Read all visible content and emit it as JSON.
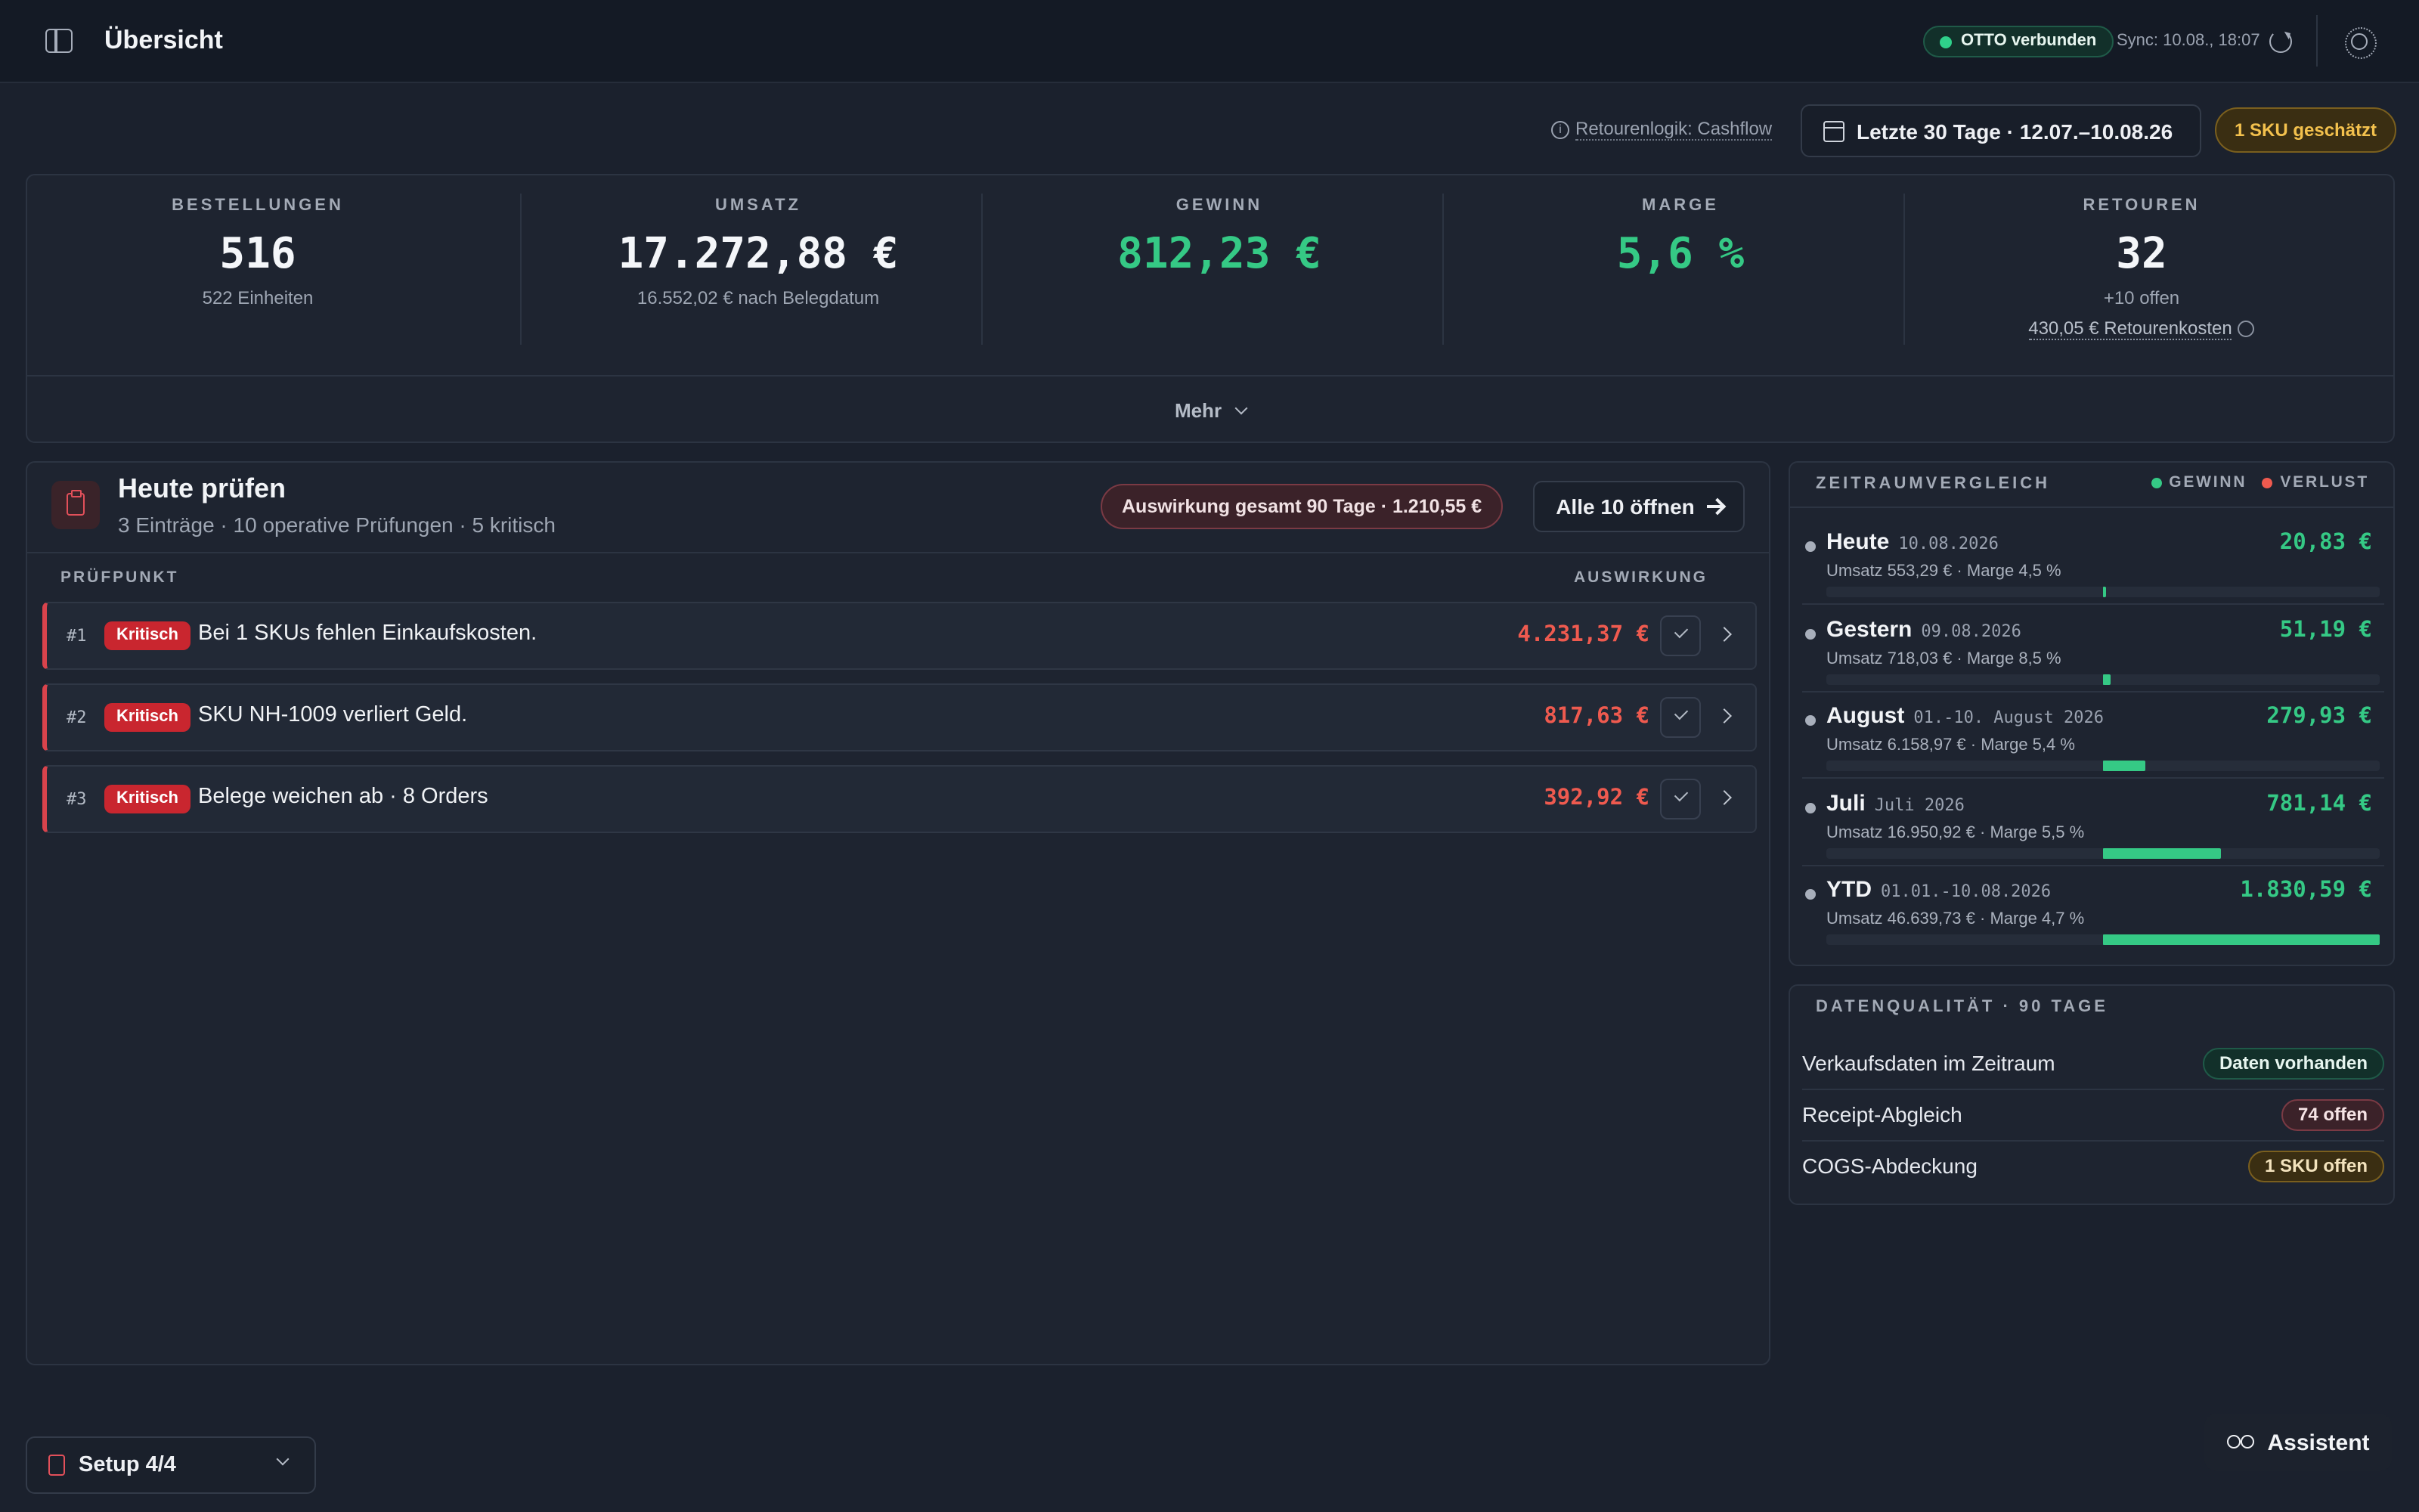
{
  "header": {
    "title": "Übersicht",
    "connection": "OTTO verbunden",
    "sync": "Sync: 10.08., 18:07",
    "icons": [
      "sidebar-toggle-icon",
      "refresh-icon",
      "sun-icon"
    ]
  },
  "filters": {
    "return_logic": "Retourenlogik: Cashflow",
    "date_range": "Letzte 30 Tage · 12.07.–10.08.26",
    "sku_estimated": "1 SKU geschätzt"
  },
  "kpis": [
    {
      "label": "BESTELLUNGEN",
      "value": "516",
      "sub": "522 Einheiten"
    },
    {
      "label": "UMSATZ",
      "value": "17.272,88 €",
      "sub": "16.552,02 € nach Belegdatum"
    },
    {
      "label": "GEWINN",
      "value": "812,23 €",
      "color": "#35c985"
    },
    {
      "label": "MARGE",
      "value": "5,6 %",
      "color": "#35c985"
    },
    {
      "label": "RETOUREN",
      "value": "32",
      "sub": "+10 offen",
      "sub2": "430,05 € Retourenkosten"
    }
  ],
  "kpi_more": "Mehr",
  "checks": {
    "title": "Heute prüfen",
    "subtitle": "3 Einträge · 10 operative Prüfungen · 5 kritisch",
    "impact_badge": "Auswirkung gesamt 90 Tage · 1.210,55 €",
    "open_all": "Alle 10 öffnen",
    "col_left": "PRÜFPUNKT",
    "col_right": "AUSWIRKUNG",
    "rows": [
      {
        "num": "#1",
        "badge": "Kritisch",
        "text": "Bei 1 SKUs fehlen Einkaufskosten.",
        "amount": "4.231,37 €"
      },
      {
        "num": "#2",
        "badge": "Kritisch",
        "text": "SKU NH-1009 verliert Geld.",
        "amount": "817,63 €"
      },
      {
        "num": "#3",
        "badge": "Kritisch",
        "text": "Belege weichen ab · 8 Orders",
        "amount": "392,92 €"
      }
    ]
  },
  "comparison": {
    "title": "ZEITRAUMVERGLEICH",
    "legend": [
      {
        "label": "GEWINN",
        "color": "#35c985"
      },
      {
        "label": "VERLUST",
        "color": "#ef5a4f"
      }
    ],
    "periods": [
      {
        "name": "Heute",
        "date": "10.08.2026",
        "value": "20,83 €",
        "sub": "Umsatz 553,29 € · Marge 4,5 %",
        "share": 0.011
      },
      {
        "name": "Gestern",
        "date": "09.08.2026",
        "value": "51,19 €",
        "sub": "Umsatz 718,03 € · Marge 8,5 %",
        "share": 0.028
      },
      {
        "name": "August",
        "date": "01.-10. August 2026",
        "value": "279,93 €",
        "sub": "Umsatz 6.158,97 € · Marge 5,4 %",
        "share": 0.153
      },
      {
        "name": "Juli",
        "date": "Juli 2026",
        "value": "781,14 €",
        "sub": "Umsatz 16.950,92 € · Marge 5,5 %",
        "share": 0.427
      },
      {
        "name": "YTD",
        "date": "01.01.-10.08.2026",
        "value": "1.830,59 €",
        "sub": "Umsatz 46.639,73 € · Marge 4,7 %",
        "share": 1.0
      }
    ]
  },
  "data_quality": {
    "title": "DATENQUALITÄT · 90 TAGE",
    "rows": [
      {
        "label": "Verkaufsdaten im Zeitraum",
        "badge": "Daten vorhanden",
        "status": "green"
      },
      {
        "label": "Receipt-Abgleich",
        "badge": "74 offen",
        "status": "red"
      },
      {
        "label": "COGS-Abdeckung",
        "badge": "1 SKU offen",
        "status": "yellow"
      }
    ]
  },
  "footer": {
    "setup": "Setup 4/4",
    "assistant": "Assistent"
  }
}
